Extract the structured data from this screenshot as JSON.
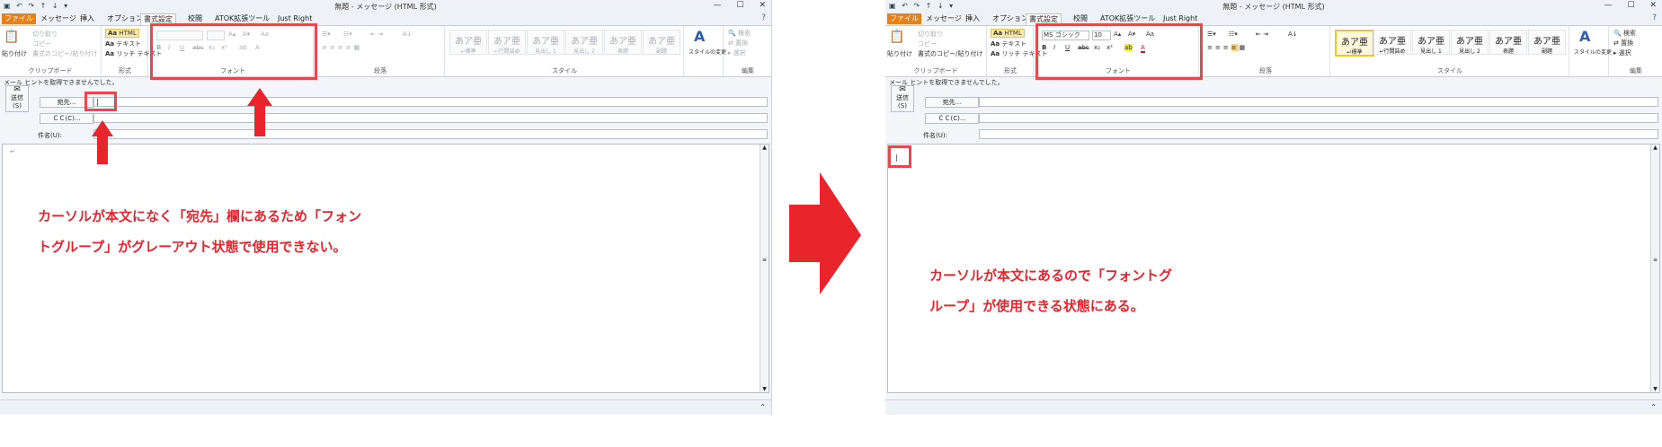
{
  "window": {
    "title": "無題 - メッセージ (HTML 形式)",
    "qat_glyphs": "▣ ↶ ↷ ↑ ↓ ▾",
    "controls": {
      "minimize": "—",
      "maximize": "☐",
      "close": "✕"
    }
  },
  "ribbon_tabs": [
    "ファイル",
    "メッセージ",
    "挿入",
    "オプション",
    "書式設定",
    "校閲",
    "ATOK拡張ツール",
    "Just Right"
  ],
  "clipboard": {
    "paste": "貼り付け",
    "cut": "切り取り",
    "copy": "コピー",
    "format_painter": "書式のコピー/貼り付け",
    "group_label": "クリップボード"
  },
  "format_group": {
    "html": "HTML",
    "text": "テキスト",
    "rich_text": "リッチ テキスト",
    "group_label": "形式"
  },
  "font_group": {
    "group_label": "フォント",
    "font_name": "MS ゴシック",
    "font_size": "10",
    "font_name_placeholder": "",
    "font_size_placeholder": "",
    "grow": "A▴",
    "shrink": "A▾",
    "case": "Aa",
    "bold": "B",
    "italic": "I",
    "underline": "U",
    "strike": "abc",
    "subscript": "x₂",
    "superscript": "x²",
    "highlight": "ab",
    "font_color": "A"
  },
  "paragraph_group": {
    "group_label": "段落",
    "bullets": "☰▾",
    "numbering": "☷▾",
    "indent": "⇤ ⇥",
    "sort": "A↓"
  },
  "style_group": {
    "group_label": "スタイル",
    "preview": "あア亜",
    "styles": [
      "↵標準",
      "↵行間詰め",
      "見出し 1",
      "見出し 2",
      "表題",
      "副題"
    ],
    "change_styles": "スタイルの変更"
  },
  "edit_group": {
    "group_label": "編集",
    "find": "検索",
    "replace": "置換",
    "select": "選択"
  },
  "message": {
    "info_bar": "メール ヒントを取得できませんでした。",
    "send": "送信",
    "send_key": "(S)",
    "to": "宛先...",
    "cc": "ＣＣ(C)...",
    "subject": "件名(U):",
    "to_value": "|",
    "body_mark": "↵"
  },
  "captions": {
    "left_line1": "カーソルが本文になく「宛先」欄にあるため「フォン",
    "left_line2": "トグループ」がグレーアウト状態で使用できない。",
    "right_line1": "カーソルが本文にあるので「フォントグ",
    "right_line2": "ループ」が使用できる状態にある。"
  },
  "colors": {
    "accent_red": "#e8242c",
    "highlight_border": "#e8474f",
    "file_tab": "#e8801a",
    "selected_style": "#f0c040"
  }
}
